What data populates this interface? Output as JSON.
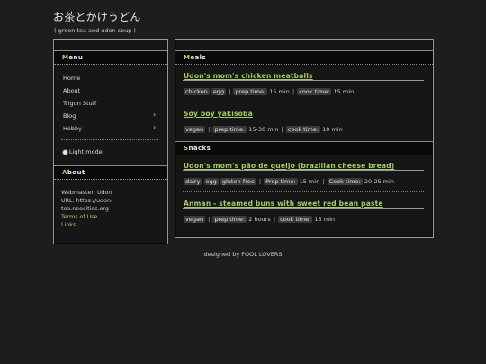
{
  "site": {
    "title": "お茶とかけうどん",
    "subtitle": "( green tea and udon soup )"
  },
  "menu": {
    "heading_first": "M",
    "heading_rest": "enu",
    "items": [
      {
        "label": "Home"
      },
      {
        "label": "About"
      },
      {
        "label": "Trigun Stuff"
      },
      {
        "label": "Blog"
      },
      {
        "label": "Hobby"
      }
    ],
    "light_mode": {
      "icon": "sun-icon",
      "label": "Light mode"
    }
  },
  "about": {
    "heading_first": "A",
    "heading_rest": "bout",
    "webmaster": "Webmaster: Udon",
    "url_line1": "URL: https://udon-",
    "url_line2": "tea.neocities.org",
    "terms": "Terms of Use",
    "links": "Links"
  },
  "meals": {
    "heading_first": "M",
    "heading_rest": "eals",
    "recipes": [
      {
        "title": "Udon's mom's chicken meatballs",
        "tags": [
          "chicken",
          "egg"
        ],
        "prep_label": "prep time:",
        "prep": "15 min",
        "cook_label": "cook time:",
        "cook": "15 min"
      },
      {
        "title": "Soy boy yakisoba",
        "tags": [
          "vegan"
        ],
        "prep_label": "prep time:",
        "prep": "15-30 min",
        "cook_label": "cook time:",
        "cook": "10 min"
      }
    ]
  },
  "snacks": {
    "heading_first": "S",
    "heading_rest": "nacks",
    "recipes": [
      {
        "title": "Udon's mom's pão de queijo (brazilian cheese bread)",
        "tags": [
          "dairy",
          "egg",
          "gluten-free"
        ],
        "prep_label": "Prep time:",
        "prep": "15 min",
        "cook_label": "Cook time:",
        "cook": "20-25 min"
      },
      {
        "title": "Anman - steamed buns with sweet red bean paste",
        "tags": [
          "vegan"
        ],
        "prep_label": "prep time:",
        "prep": "2 hours",
        "cook_label": "cook time:",
        "cook": "15 min"
      }
    ]
  },
  "footer": {
    "text": "designed by FOOL LOVERS"
  },
  "colors": {
    "accent": "#a9c96a",
    "background": "#1d1d1d"
  }
}
